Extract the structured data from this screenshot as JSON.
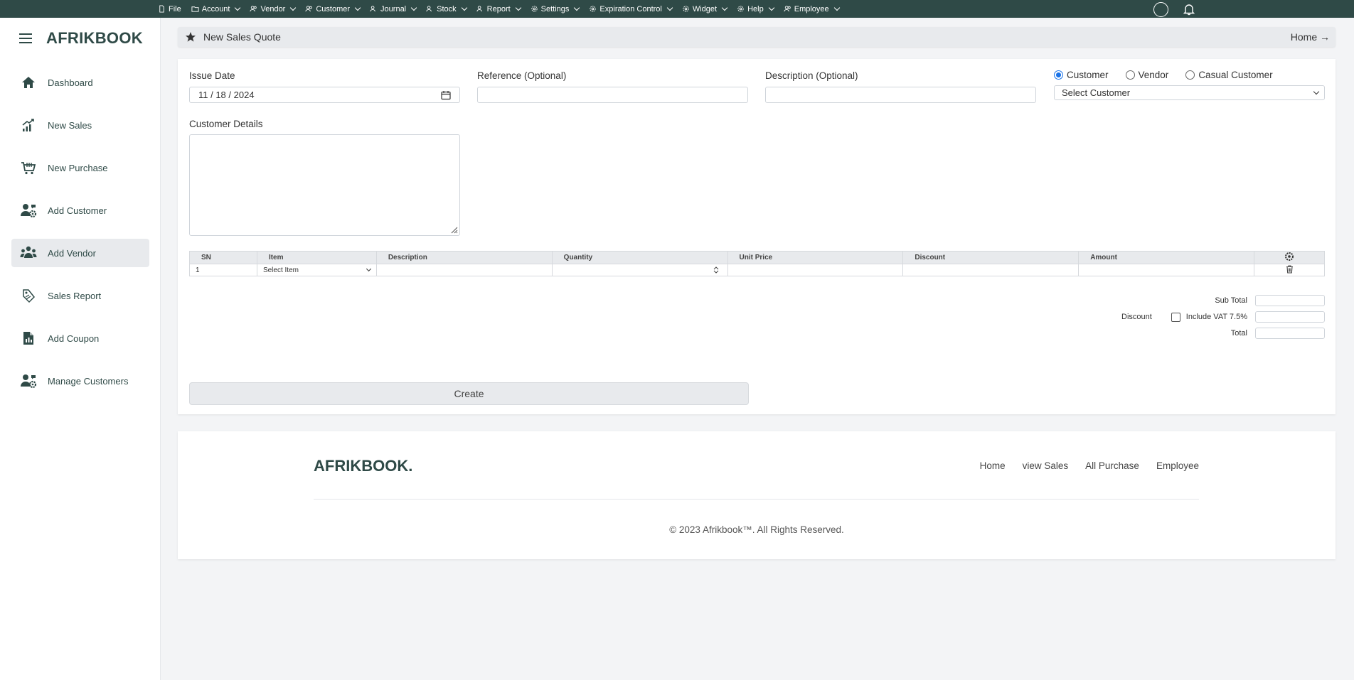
{
  "topbar": {
    "menu": [
      {
        "label": "File",
        "icon": "file-icon",
        "dropdown": false
      },
      {
        "label": "Account",
        "icon": "folder-icon",
        "dropdown": true
      },
      {
        "label": "Vendor",
        "icon": "users-icon",
        "dropdown": true
      },
      {
        "label": "Customer",
        "icon": "users-icon",
        "dropdown": true
      },
      {
        "label": "Journal",
        "icon": "users-icon",
        "dropdown": true
      },
      {
        "label": "Stock",
        "icon": "users-icon",
        "dropdown": true
      },
      {
        "label": "Report",
        "icon": "users-icon",
        "dropdown": true
      },
      {
        "label": "Settings",
        "icon": "gear-icon",
        "dropdown": true
      },
      {
        "label": "Expiration Control",
        "icon": "gear-icon",
        "dropdown": true
      },
      {
        "label": "Widget",
        "icon": "gear-icon",
        "dropdown": true
      },
      {
        "label": "Help",
        "icon": "gear-icon",
        "dropdown": true
      },
      {
        "label": "Employee",
        "icon": "users-icon",
        "dropdown": true
      }
    ]
  },
  "sidebar": {
    "brand": "AFRIKBOOK",
    "items": [
      {
        "label": "Dashboard",
        "icon": "home-icon"
      },
      {
        "label": "New Sales",
        "icon": "chart-growth-icon"
      },
      {
        "label": "New Purchase",
        "icon": "cart-icon"
      },
      {
        "label": "Add Customer",
        "icon": "user-gear-icon"
      },
      {
        "label": "Add Vendor",
        "icon": "people-group-icon"
      },
      {
        "label": "Sales Report",
        "icon": "tags-icon"
      },
      {
        "label": "Add Coupon",
        "icon": "document-chart-icon"
      },
      {
        "label": "Manage Customers",
        "icon": "user-gear-icon"
      }
    ]
  },
  "header": {
    "title": "New Sales Quote",
    "home_link": "Home →"
  },
  "form": {
    "issue_date_label": "Issue Date",
    "issue_date_value": "11 / 18 / 2024",
    "reference_label": "Reference (Optional)",
    "description_label": "Description (Optional)",
    "radio_customer": "Customer",
    "radio_vendor": "Vendor",
    "radio_casual": "Casual Customer",
    "select_customer": "Select Customer",
    "customer_details_label": "Customer Details"
  },
  "table": {
    "headers": [
      "SN",
      "Item",
      "Description",
      "Quantity",
      "Unit Price",
      "Discount",
      "Amount"
    ],
    "row_sn": "1",
    "row_item_placeholder": "Select Item"
  },
  "totals": {
    "subtotal_label": "Sub Total",
    "discount_label": "Discount",
    "vat_label": "Include VAT 7.5%",
    "total_label": "Total"
  },
  "create_button": "Create",
  "footer": {
    "brand": "AFRIKBOOK.",
    "links": [
      "Home",
      "view Sales",
      "All Purchase",
      "Employee"
    ],
    "copyright": "© 2023 Afrikbook™. All Rights Reserved."
  },
  "colors": {
    "brand": "#2f4a47",
    "accent": "#1a73e8",
    "panel": "#e8eaed"
  }
}
